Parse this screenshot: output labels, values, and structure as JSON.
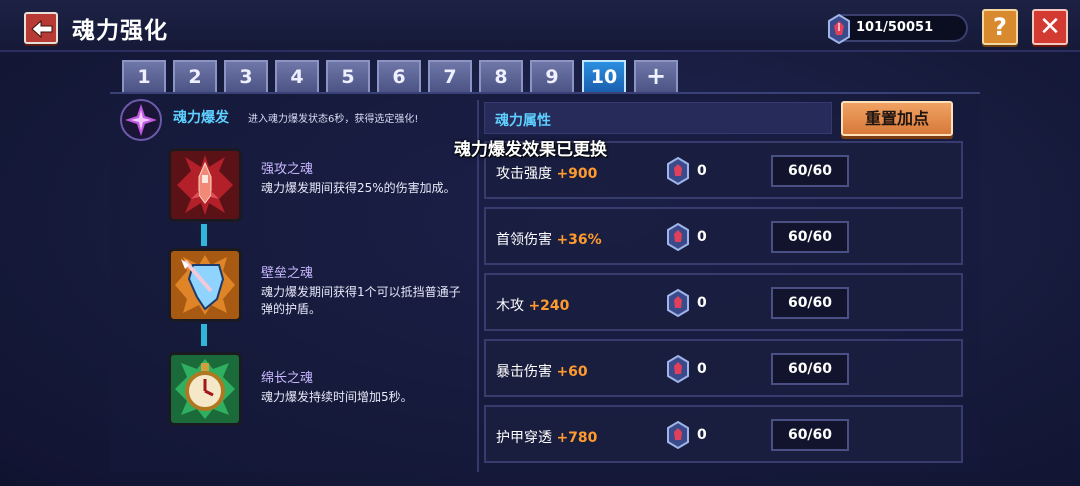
{
  "header": {
    "title": "魂力强化",
    "currency": "101/50051",
    "help_label": "?",
    "close_label": "✕"
  },
  "tabs": [
    {
      "label": "1"
    },
    {
      "label": "2"
    },
    {
      "label": "3"
    },
    {
      "label": "4"
    },
    {
      "label": "5"
    },
    {
      "label": "6"
    },
    {
      "label": "7"
    },
    {
      "label": "8"
    },
    {
      "label": "9"
    },
    {
      "label": "10",
      "active": true
    },
    {
      "label": "+"
    }
  ],
  "burst": {
    "title": "魂力爆发",
    "description": "进入魂力爆发状态6秒，获得选定强化!"
  },
  "souls": [
    {
      "name": "强攻之魂",
      "description": "魂力爆发期间获得25%的伤害加成。"
    },
    {
      "name": "壁垒之魂",
      "description": "魂力爆发期间获得1个可以抵挡普通子弹的护盾。"
    },
    {
      "name": "绵长之魂",
      "description": "魂力爆发持续时间增加5秒。"
    }
  ],
  "attributes": {
    "header": "魂力属性",
    "reset_label": "重置加点",
    "toast": "魂力爆发效果已更换",
    "rows": [
      {
        "name": "攻击强度",
        "bonus": "+900",
        "cost": "0",
        "level": "60/60"
      },
      {
        "name": "首领伤害",
        "bonus": "+36%",
        "cost": "0",
        "level": "60/60"
      },
      {
        "name": "木攻",
        "bonus": "+240",
        "cost": "0",
        "level": "60/60"
      },
      {
        "name": "暴击伤害",
        "bonus": "+60",
        "cost": "0",
        "level": "60/60"
      },
      {
        "name": "护甲穿透",
        "bonus": "+780",
        "cost": "0",
        "level": "60/60"
      }
    ]
  },
  "colors": {
    "accent": "#5ed0ff",
    "bonus": "#ff9b2e",
    "tab_active": "#2b8fe0"
  }
}
